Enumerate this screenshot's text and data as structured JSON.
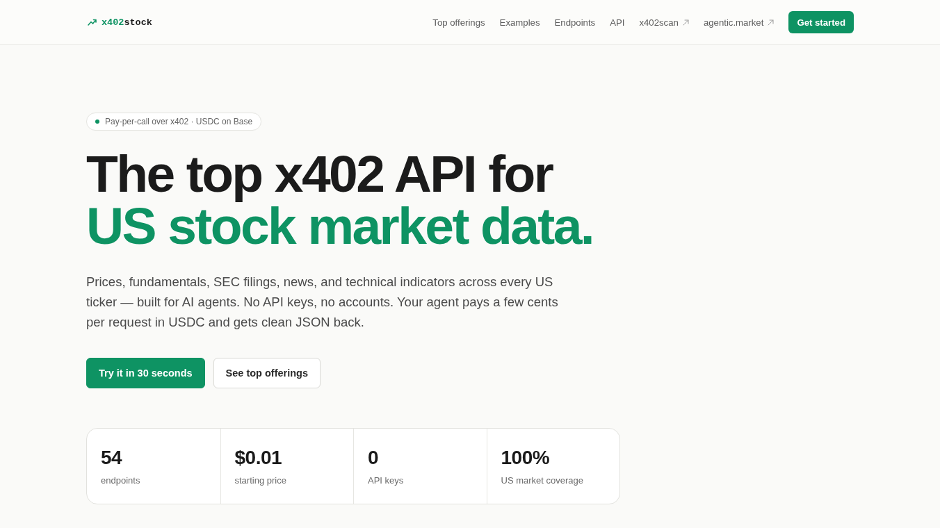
{
  "header": {
    "logo": {
      "prefix": "x402",
      "suffix": "stock"
    },
    "nav": [
      {
        "label": "Top offerings",
        "external": false
      },
      {
        "label": "Examples",
        "external": false
      },
      {
        "label": "Endpoints",
        "external": false
      },
      {
        "label": "API",
        "external": false
      },
      {
        "label": "x402scan",
        "external": true
      },
      {
        "label": "agentic.market",
        "external": true
      }
    ],
    "cta": "Get started"
  },
  "hero": {
    "badge": "Pay-per-call over x402 · USDC on Base",
    "title_line_1": "The top x402 API for",
    "title_line_2": "US stock market data.",
    "description": "Prices, fundamentals, SEC filings, news, and technical indicators across every US ticker — built for AI agents. No API keys, no accounts. Your agent pays a few cents per request in USDC and gets clean JSON back.",
    "buttons": [
      {
        "label": "Try it in 30 seconds",
        "kind": "primary"
      },
      {
        "label": "See top offerings",
        "kind": "secondary"
      }
    ]
  },
  "stats": [
    {
      "value": "54",
      "label": "endpoints"
    },
    {
      "value": "$0.01",
      "label": "starting price"
    },
    {
      "value": "0",
      "label": "API keys"
    },
    {
      "value": "100%",
      "label": "US market coverage"
    }
  ]
}
